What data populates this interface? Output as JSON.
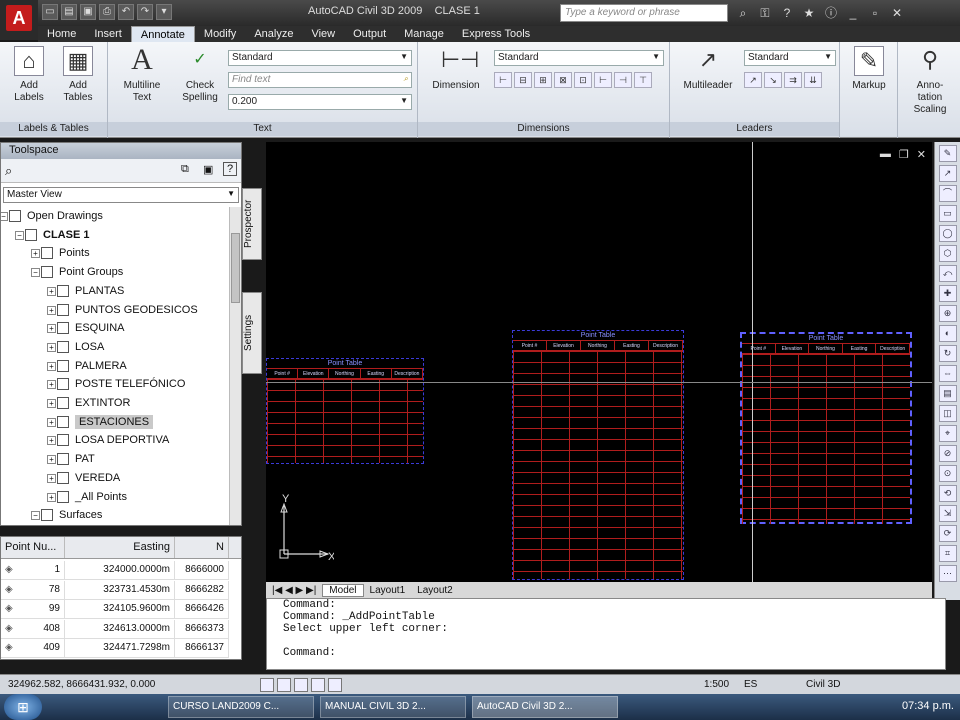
{
  "titlebar": {
    "app_letter": "A",
    "title": "AutoCAD Civil 3D 2009",
    "doc": "CLASE 1",
    "search_placeholder": "Type a keyword or phrase"
  },
  "tabs": [
    "Home",
    "Insert",
    "Annotate",
    "Modify",
    "Analyze",
    "View",
    "Output",
    "Manage",
    "Express Tools"
  ],
  "active_tab": "Annotate",
  "ribbon": {
    "labels_tables": {
      "title": "Labels & Tables",
      "add_labels": "Add\nLabels",
      "add_tables": "Add\nTables"
    },
    "text": {
      "title": "Text",
      "multiline": "Multiline\nText",
      "check": "Check\nSpelling",
      "style": "Standard",
      "find": "Find text",
      "height": "0.200"
    },
    "dimensions": {
      "title": "Dimensions",
      "dimension": "Dimension",
      "style": "Standard"
    },
    "leaders": {
      "title": "Leaders",
      "multileader": "Multileader",
      "style": "Standard"
    },
    "markup": "Markup",
    "scaling": "Anno-\ntation\nScaling"
  },
  "toolspace": {
    "header": "Toolspace",
    "view": "Master View",
    "tree": [
      {
        "label": "Open Drawings",
        "level": 0
      },
      {
        "label": "CLASE 1",
        "level": 1,
        "bold": true
      },
      {
        "label": "Points",
        "level": 2
      },
      {
        "label": "Point Groups",
        "level": 2
      },
      {
        "label": "PLANTAS",
        "level": 3
      },
      {
        "label": "PUNTOS GEODESICOS",
        "level": 3
      },
      {
        "label": "ESQUINA",
        "level": 3
      },
      {
        "label": "LOSA",
        "level": 3
      },
      {
        "label": "PALMERA",
        "level": 3
      },
      {
        "label": "POSTE TELEFÓNICO",
        "level": 3
      },
      {
        "label": "EXTINTOR",
        "level": 3
      },
      {
        "label": "ESTACIONES",
        "level": 3,
        "selected": true
      },
      {
        "label": "LOSA DEPORTIVA",
        "level": 3
      },
      {
        "label": "PAT",
        "level": 3
      },
      {
        "label": "VEREDA",
        "level": 3
      },
      {
        "label": "_All Points",
        "level": 3
      },
      {
        "label": "Surfaces",
        "level": 2
      }
    ],
    "vtabs": [
      "Prospector",
      "Settings"
    ]
  },
  "point_list": {
    "headers": [
      "Point Nu...",
      "Easting",
      "N"
    ],
    "rows": [
      [
        "1",
        "324000.0000m",
        "8666000"
      ],
      [
        "78",
        "323731.4530m",
        "8666282"
      ],
      [
        "99",
        "324105.9600m",
        "8666426"
      ],
      [
        "408",
        "324613.0000m",
        "8666373"
      ],
      [
        "409",
        "324471.7298m",
        "8666137"
      ]
    ]
  },
  "drawing": {
    "table_title": "Point Table",
    "table_cols": [
      "Point #",
      "Elevation",
      "Northing",
      "Easting",
      "Description"
    ],
    "ucs_y": "Y",
    "ucs_x": "X"
  },
  "layout_tabs": [
    "Model",
    "Layout1",
    "Layout2"
  ],
  "command_lines": [
    "Command:",
    "Command: _AddPointTable",
    "Select upper left corner:",
    "",
    "Command:"
  ],
  "status": {
    "coords": "324962.582, 8666431.932, 0.000",
    "scale": "1:500",
    "workspace": "Civil 3D",
    "lang": "ES"
  },
  "taskbar": {
    "items": [
      "CURSO LAND2009 C...",
      "MANUAL CIVIL 3D 2...",
      "AutoCAD Civil 3D 2..."
    ],
    "time": "07:34 p.m."
  }
}
